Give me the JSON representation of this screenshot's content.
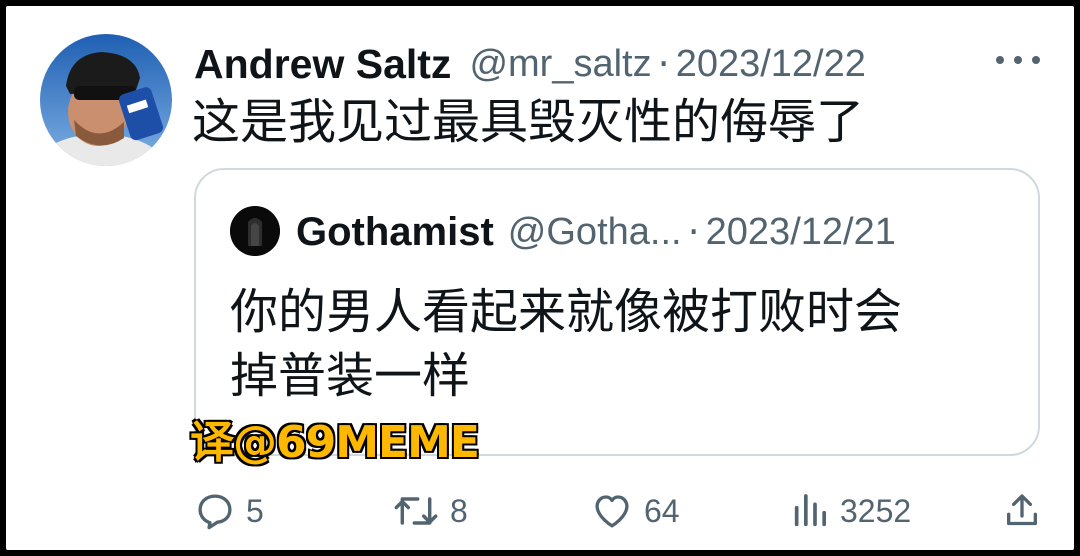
{
  "tweet": {
    "display_name": "Andrew Saltz",
    "handle": "@mr_saltz",
    "separator": "·",
    "date": "2023/12/22",
    "text": "这是我见过最具毁灭性的侮辱了"
  },
  "quoted_tweet": {
    "display_name": "Gothamist",
    "handle": "@Gotha...",
    "separator": "·",
    "date": "2023/12/21",
    "text_line1": "你的男人看起来就像被打败时会",
    "text_line2": "掉普装一样"
  },
  "watermark": "译@69MEME",
  "actions": {
    "reply_count": "5",
    "retweet_count": "8",
    "like_count": "64",
    "views_count": "3252"
  },
  "icons": [
    "more-icon",
    "reply-icon",
    "retweet-icon",
    "like-icon",
    "views-icon",
    "share-icon"
  ],
  "colors": {
    "text_primary": "#0f1419",
    "text_secondary": "#536471",
    "border": "#cfd9de",
    "watermark": "#ffb800"
  }
}
